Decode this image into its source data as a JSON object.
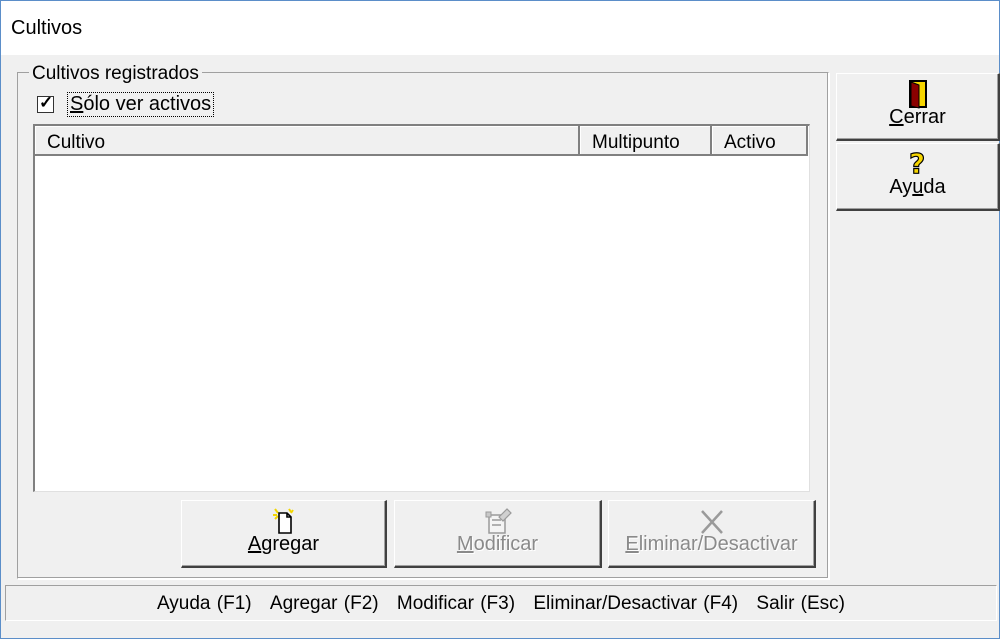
{
  "window": {
    "title": "Cultivos"
  },
  "group": {
    "legend": "Cultivos registrados",
    "checkbox": {
      "label": "Sólo ver activos",
      "checked": true
    }
  },
  "list": {
    "columns": [
      "Cultivo",
      "Multipunto",
      "Activo"
    ],
    "rows": []
  },
  "buttons": {
    "agregar": {
      "label_u": "A",
      "label_rest": "gregar",
      "icon": "new-document-icon",
      "enabled": true
    },
    "modificar": {
      "label_u": "M",
      "label_rest": "odificar",
      "icon": "edit-document-icon",
      "enabled": false
    },
    "eliminar": {
      "label_u": "E",
      "label_rest": "liminar/Desactivar",
      "icon": "delete-x-icon",
      "enabled": false
    },
    "cerrar": {
      "label_u": "C",
      "label_rest": "errar",
      "icon": "exit-door-icon",
      "enabled": true
    },
    "ayuda": {
      "label_pre": "Ay",
      "label_u": "u",
      "label_rest": "da",
      "icon": "help-question-icon",
      "enabled": true
    }
  },
  "statusbar": {
    "items": [
      "Ayuda (F1)",
      "Agregar (F2)",
      "Modificar (F3)",
      "Eliminar/Desactivar (F4)",
      "Salir (Esc)"
    ]
  },
  "colors": {
    "window_border": "#5b8ec9",
    "background": "#f0f0f0",
    "door": "#f6d500",
    "door_dark": "#8b0000"
  }
}
